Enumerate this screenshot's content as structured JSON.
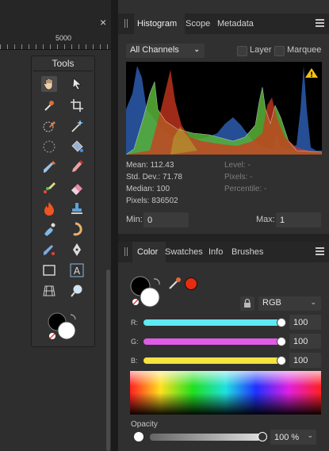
{
  "canvas": {
    "ruler_value": "5000",
    "close_glyph": "×"
  },
  "tools_panel": {
    "title": "Tools",
    "tools": [
      {
        "name": "view-tool-icon"
      },
      {
        "name": "move-tool-icon"
      },
      {
        "name": "color-picker-tool-icon"
      },
      {
        "name": "crop-tool-icon"
      },
      {
        "name": "selection-brush-tool-icon"
      },
      {
        "name": "magic-wand-tool-icon"
      },
      {
        "name": "marquee-tool-icon"
      },
      {
        "name": "flood-fill-tool-icon"
      },
      {
        "name": "paint-brush-tool-icon"
      },
      {
        "name": "pixel-tool-icon"
      },
      {
        "name": "color-replacement-tool-icon"
      },
      {
        "name": "erase-brush-tool-icon"
      },
      {
        "name": "dodge-burn-tool-icon"
      },
      {
        "name": "clone-stamp-tool-icon"
      },
      {
        "name": "smudge-tool-icon"
      },
      {
        "name": "liquify-tool-icon"
      },
      {
        "name": "inpainting-tool-icon"
      },
      {
        "name": "pen-tool-icon"
      },
      {
        "name": "rectangle-tool-icon"
      },
      {
        "name": "text-tool-icon"
      },
      {
        "name": "mesh-warp-tool-icon"
      },
      {
        "name": "zoom-tool-icon"
      }
    ]
  },
  "histogram_panel": {
    "tabs": [
      "Histogram",
      "Scope",
      "Metadata"
    ],
    "active_tab": "Histogram",
    "channel": "All Channels",
    "layer_label": "Layer",
    "marquee_label": "Marquee",
    "warning_glyph": "!",
    "stats_left": [
      "Mean: 112.43",
      "Std. Dev.: 71.78",
      "Median: 100",
      "Pixels: 836502"
    ],
    "stats_right": [
      "Level: -",
      "Pixels: -",
      "Percentile: -"
    ],
    "min_label": "Min:",
    "min_value": "0",
    "max_label": "Max:",
    "max_value": "1"
  },
  "color_panel": {
    "tabs": [
      "Color",
      "Swatches",
      "Info",
      "Brushes"
    ],
    "active_tab": "Color",
    "model": "RGB",
    "r_label": "R:",
    "r_value": "100",
    "g_label": "G:",
    "g_value": "100",
    "b_label": "B:",
    "b_value": "100",
    "opacity_label": "Opacity",
    "opacity_value": "100 %",
    "colors": {
      "r": "#5fe9f2",
      "g": "#df5ce6",
      "b": "#f4e341",
      "picker_dot": "#e52b10"
    }
  }
}
